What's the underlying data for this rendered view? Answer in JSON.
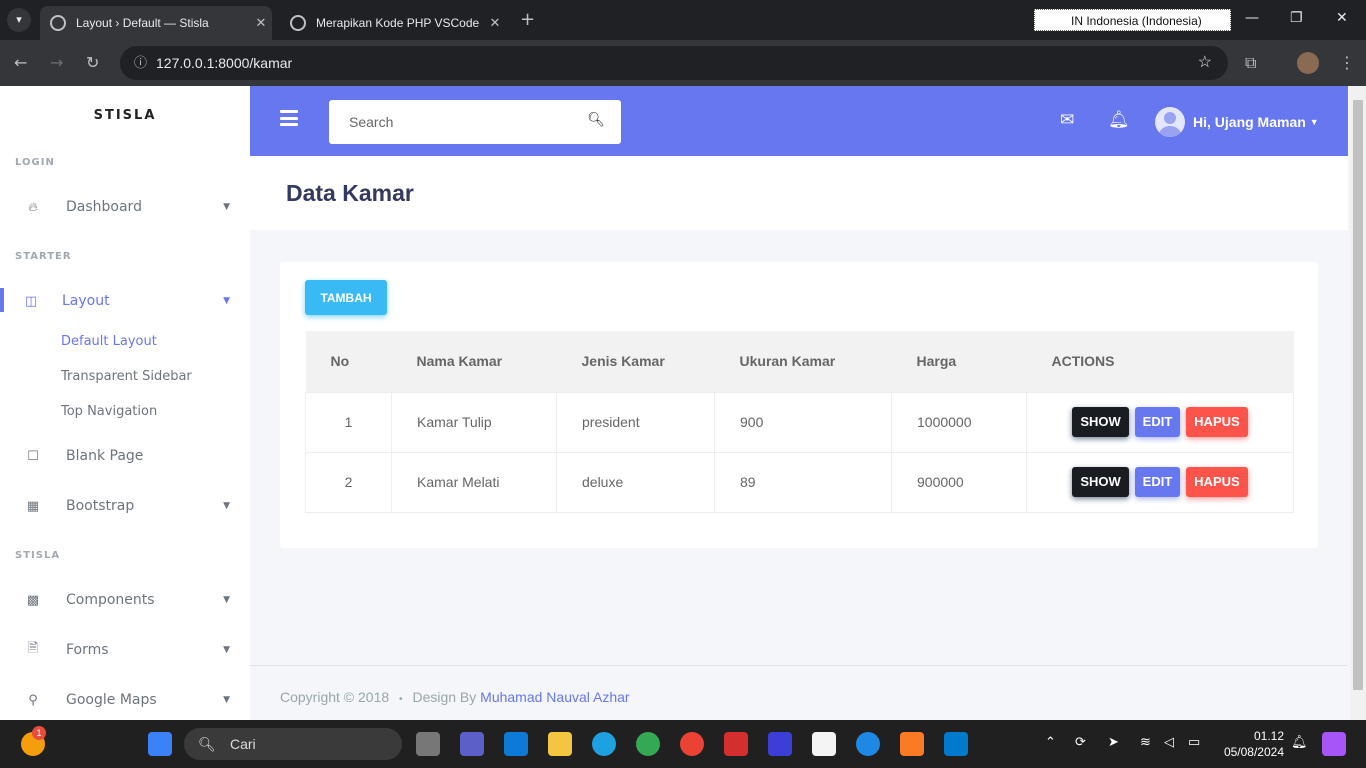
{
  "browser": {
    "tabs": [
      {
        "title": "Layout › Default — Stisla",
        "active": true
      },
      {
        "title": "Merapikan Kode PHP VSCode",
        "active": false
      }
    ],
    "language_indicator": "IN  Indonesia (Indonesia)",
    "url": "127.0.0.1:8000/kamar"
  },
  "sidebar": {
    "brand": "STISLA",
    "headers": [
      "LOGIN",
      "STARTER",
      "STISLA"
    ],
    "items": [
      {
        "label": "Dashboard",
        "icon": "fire-icon"
      },
      {
        "label": "Layout",
        "icon": "columns-icon"
      },
      {
        "label": "Blank Page",
        "icon": "square-icon"
      },
      {
        "label": "Bootstrap",
        "icon": "grid-icon"
      },
      {
        "label": "Components",
        "icon": "th-large-icon"
      },
      {
        "label": "Forms",
        "icon": "file-icon"
      },
      {
        "label": "Google Maps",
        "icon": "map-marker-icon"
      }
    ],
    "submenu": [
      "Default Layout",
      "Transparent Sidebar",
      "Top Navigation"
    ]
  },
  "topbar": {
    "search_placeholder": "Search",
    "user_greeting": "Hi, Ujang Maman"
  },
  "page": {
    "title": "Data Kamar",
    "add_button": "TAMBAH"
  },
  "table": {
    "headers": [
      "No",
      "Nama Kamar",
      "Jenis Kamar",
      "Ukuran Kamar",
      "Harga",
      "ACTIONS"
    ],
    "rows": [
      {
        "no": "1",
        "nama": "Kamar Tulip",
        "jenis": "president",
        "ukuran": "900",
        "harga": "1000000"
      },
      {
        "no": "2",
        "nama": "Kamar Melati",
        "jenis": "deluxe",
        "ukuran": "89",
        "harga": "900000"
      }
    ],
    "actions": {
      "show": "SHOW",
      "edit": "EDIT",
      "delete": "HAPUS"
    }
  },
  "footer": {
    "copyright": "Copyright © 2018",
    "separator": "•",
    "design_by": "Design By",
    "author": "Muhamad Nauval Azhar"
  },
  "taskbar": {
    "search": "Cari",
    "time": "01.12",
    "date": "05/08/2024",
    "notification_count": "1"
  },
  "colors": {
    "primary": "#6777ef",
    "info": "#3abaf4",
    "danger": "#fc544b",
    "dark": "#191d21"
  }
}
